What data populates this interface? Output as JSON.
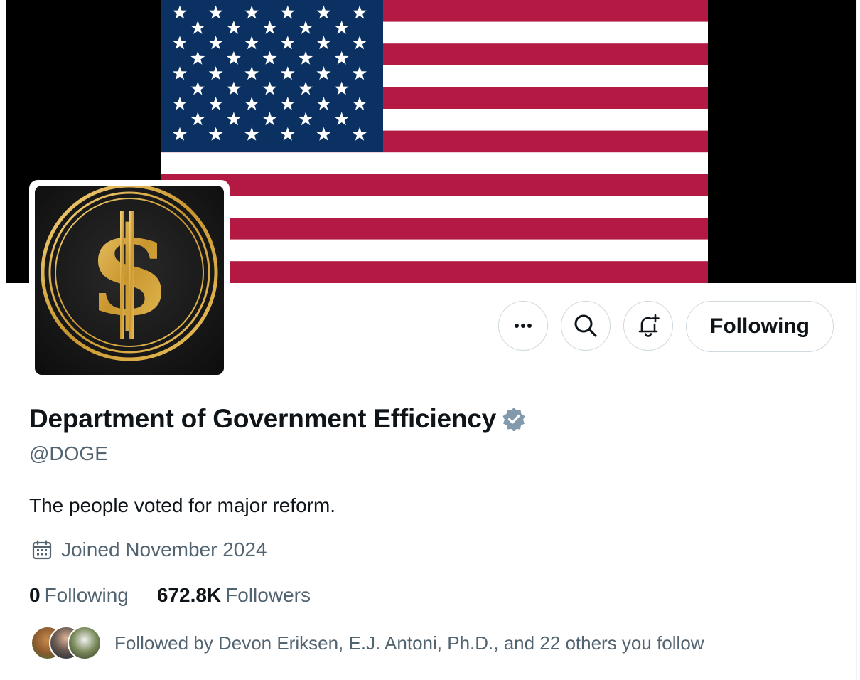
{
  "profile": {
    "display_name": "Department of Government Efficiency",
    "handle": "@DOGE",
    "bio": "The people voted for major reform.",
    "joined": "Joined November 2024",
    "verified_badge": "verified-badge-icon",
    "verified_color": "#829aab"
  },
  "stats": {
    "following_count": "0",
    "following_label": "Following",
    "followers_count": "672.8K",
    "followers_label": "Followers"
  },
  "actions": {
    "more_icon": "more-icon",
    "search_icon": "search-icon",
    "notify_icon": "bell-plus-icon",
    "follow_button_label": "Following"
  },
  "followed_by": {
    "text": "Followed by Devon Eriksen, E.J. Antoni, Ph.D., and 22 others you follow"
  },
  "colors": {
    "flag_red": "#b31942",
    "flag_blue": "#0a3161",
    "gold": "#d4a93c",
    "text_secondary": "#536471",
    "border": "#cfd9de"
  }
}
